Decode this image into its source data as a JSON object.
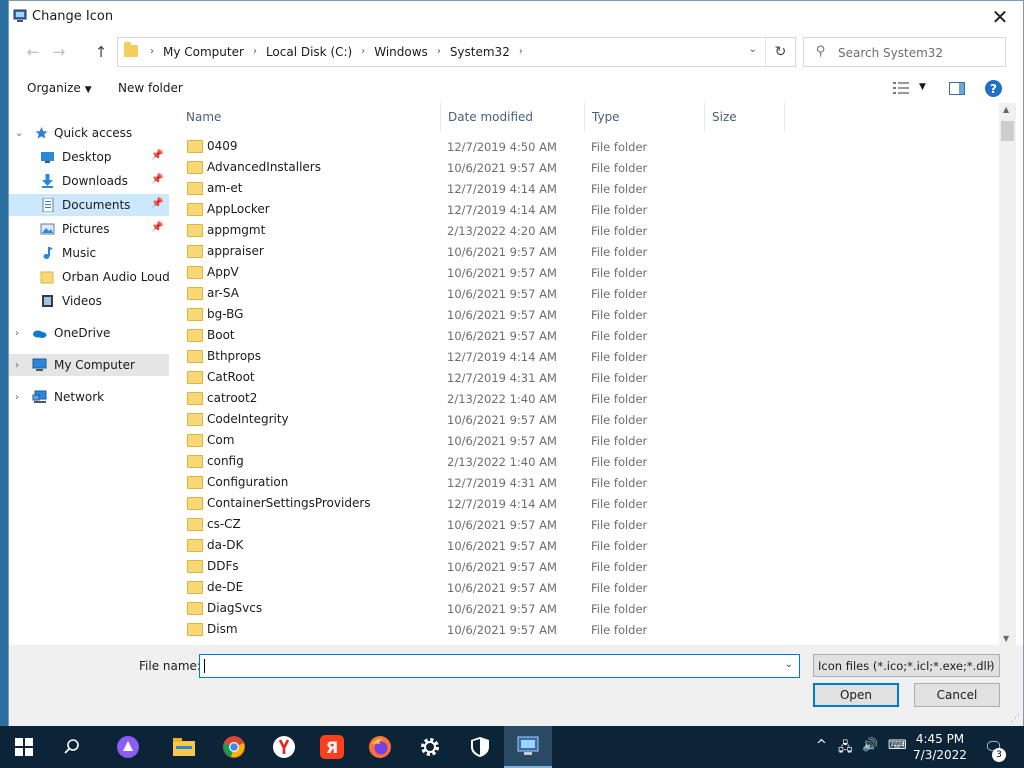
{
  "window": {
    "title": "Change Icon"
  },
  "address": {
    "crumbs": [
      "My Computer",
      "Local Disk (C:)",
      "Windows",
      "System32"
    ]
  },
  "search": {
    "placeholder": "Search System32"
  },
  "toolbar": {
    "organize_label": "Organize",
    "new_folder_label": "New folder"
  },
  "navpane": {
    "items": [
      {
        "label": "Quick access",
        "icon": "star-icon"
      },
      {
        "label": "Desktop",
        "icon": "desktop-icon",
        "pinned": true
      },
      {
        "label": "Downloads",
        "icon": "download-icon",
        "pinned": true
      },
      {
        "label": "Documents",
        "icon": "document-icon",
        "pinned": true
      },
      {
        "label": "Pictures",
        "icon": "pictures-icon",
        "pinned": true
      },
      {
        "label": "Music",
        "icon": "music-icon"
      },
      {
        "label": "Orban Audio Loudr",
        "icon": "folder-icon"
      },
      {
        "label": "Videos",
        "icon": "videos-icon"
      },
      {
        "label": "OneDrive",
        "icon": "cloud-icon"
      },
      {
        "label": "My Computer",
        "icon": "computer-icon"
      },
      {
        "label": "Network",
        "icon": "network-icon"
      }
    ]
  },
  "columns": {
    "name": "Name",
    "date": "Date modified",
    "type": "Type",
    "size": "Size"
  },
  "files": [
    {
      "name": "0409",
      "date": "12/7/2019 4:50 AM",
      "type": "File folder"
    },
    {
      "name": "AdvancedInstallers",
      "date": "10/6/2021 9:57 AM",
      "type": "File folder"
    },
    {
      "name": "am-et",
      "date": "12/7/2019 4:14 AM",
      "type": "File folder"
    },
    {
      "name": "AppLocker",
      "date": "12/7/2019 4:14 AM",
      "type": "File folder"
    },
    {
      "name": "appmgmt",
      "date": "2/13/2022 4:20 AM",
      "type": "File folder"
    },
    {
      "name": "appraiser",
      "date": "10/6/2021 9:57 AM",
      "type": "File folder"
    },
    {
      "name": "AppV",
      "date": "10/6/2021 9:57 AM",
      "type": "File folder"
    },
    {
      "name": "ar-SA",
      "date": "10/6/2021 9:57 AM",
      "type": "File folder"
    },
    {
      "name": "bg-BG",
      "date": "10/6/2021 9:57 AM",
      "type": "File folder"
    },
    {
      "name": "Boot",
      "date": "10/6/2021 9:57 AM",
      "type": "File folder"
    },
    {
      "name": "Bthprops",
      "date": "12/7/2019 4:14 AM",
      "type": "File folder"
    },
    {
      "name": "CatRoot",
      "date": "12/7/2019 4:31 AM",
      "type": "File folder"
    },
    {
      "name": "catroot2",
      "date": "2/13/2022 1:40 AM",
      "type": "File folder"
    },
    {
      "name": "CodeIntegrity",
      "date": "10/6/2021 9:57 AM",
      "type": "File folder"
    },
    {
      "name": "Com",
      "date": "10/6/2021 9:57 AM",
      "type": "File folder"
    },
    {
      "name": "config",
      "date": "2/13/2022 1:40 AM",
      "type": "File folder"
    },
    {
      "name": "Configuration",
      "date": "12/7/2019 4:31 AM",
      "type": "File folder"
    },
    {
      "name": "ContainerSettingsProviders",
      "date": "12/7/2019 4:14 AM",
      "type": "File folder"
    },
    {
      "name": "cs-CZ",
      "date": "10/6/2021 9:57 AM",
      "type": "File folder"
    },
    {
      "name": "da-DK",
      "date": "10/6/2021 9:57 AM",
      "type": "File folder"
    },
    {
      "name": "DDFs",
      "date": "10/6/2021 9:57 AM",
      "type": "File folder"
    },
    {
      "name": "de-DE",
      "date": "10/6/2021 9:57 AM",
      "type": "File folder"
    },
    {
      "name": "DiagSvcs",
      "date": "10/6/2021 9:57 AM",
      "type": "File folder"
    },
    {
      "name": "Dism",
      "date": "10/6/2021 9:57 AM",
      "type": "File folder"
    }
  ],
  "bottom": {
    "file_name_label": "File name:",
    "file_name_value": "",
    "filter_value": "Icon files (*.ico;*.icl;*.exe;*.dll)",
    "open_label": "Open",
    "cancel_label": "Cancel"
  },
  "taskbar": {
    "apps": [
      "start-icon",
      "search-icon",
      "alice-icon",
      "file-explorer-icon",
      "chrome-icon",
      "yandex-browser-icon",
      "yandex-icon",
      "firefox-icon",
      "settings-icon",
      "security-icon",
      "display-settings-icon"
    ],
    "time": "4:45 PM",
    "date": "7/3/2022",
    "notification_count": "3"
  },
  "colors": {
    "accent": "#0078d7",
    "folder": "#f8d775",
    "taskbar": "#0b2438"
  }
}
